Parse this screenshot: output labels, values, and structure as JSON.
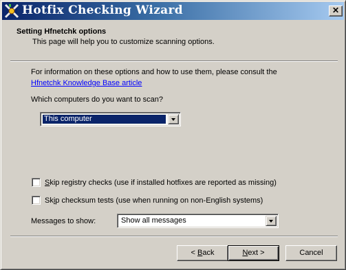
{
  "window": {
    "title": "Hotfix Checking Wizard",
    "close_glyph": "✕",
    "app_icon": "wizard-icon"
  },
  "header": {
    "title": "Setting Hfnetchk options",
    "subtitle": "This page will help you to customize scanning options."
  },
  "body": {
    "info_text": "For information on these options and how to use them, please consult the",
    "link_text": "Hfnetchk Knowledge Base article",
    "computers_label": "Which computers do you want to scan?",
    "computers_value": "This computer",
    "skip_registry": {
      "access": "S",
      "rest": "kip registry checks (use if installed hotfixes are reported as missing)",
      "checked": false
    },
    "skip_checksum": {
      "access": "i",
      "pre": "Sk",
      "rest": "p checksum tests (use when running on non-English systems)",
      "checked": false
    },
    "messages_label": "Messages to show:",
    "messages_value": "Show all messages"
  },
  "footer": {
    "back": {
      "prefix": "< ",
      "access": "B",
      "rest": "ack"
    },
    "next": {
      "access": "N",
      "rest": "ext >"
    },
    "cancel": "Cancel"
  }
}
